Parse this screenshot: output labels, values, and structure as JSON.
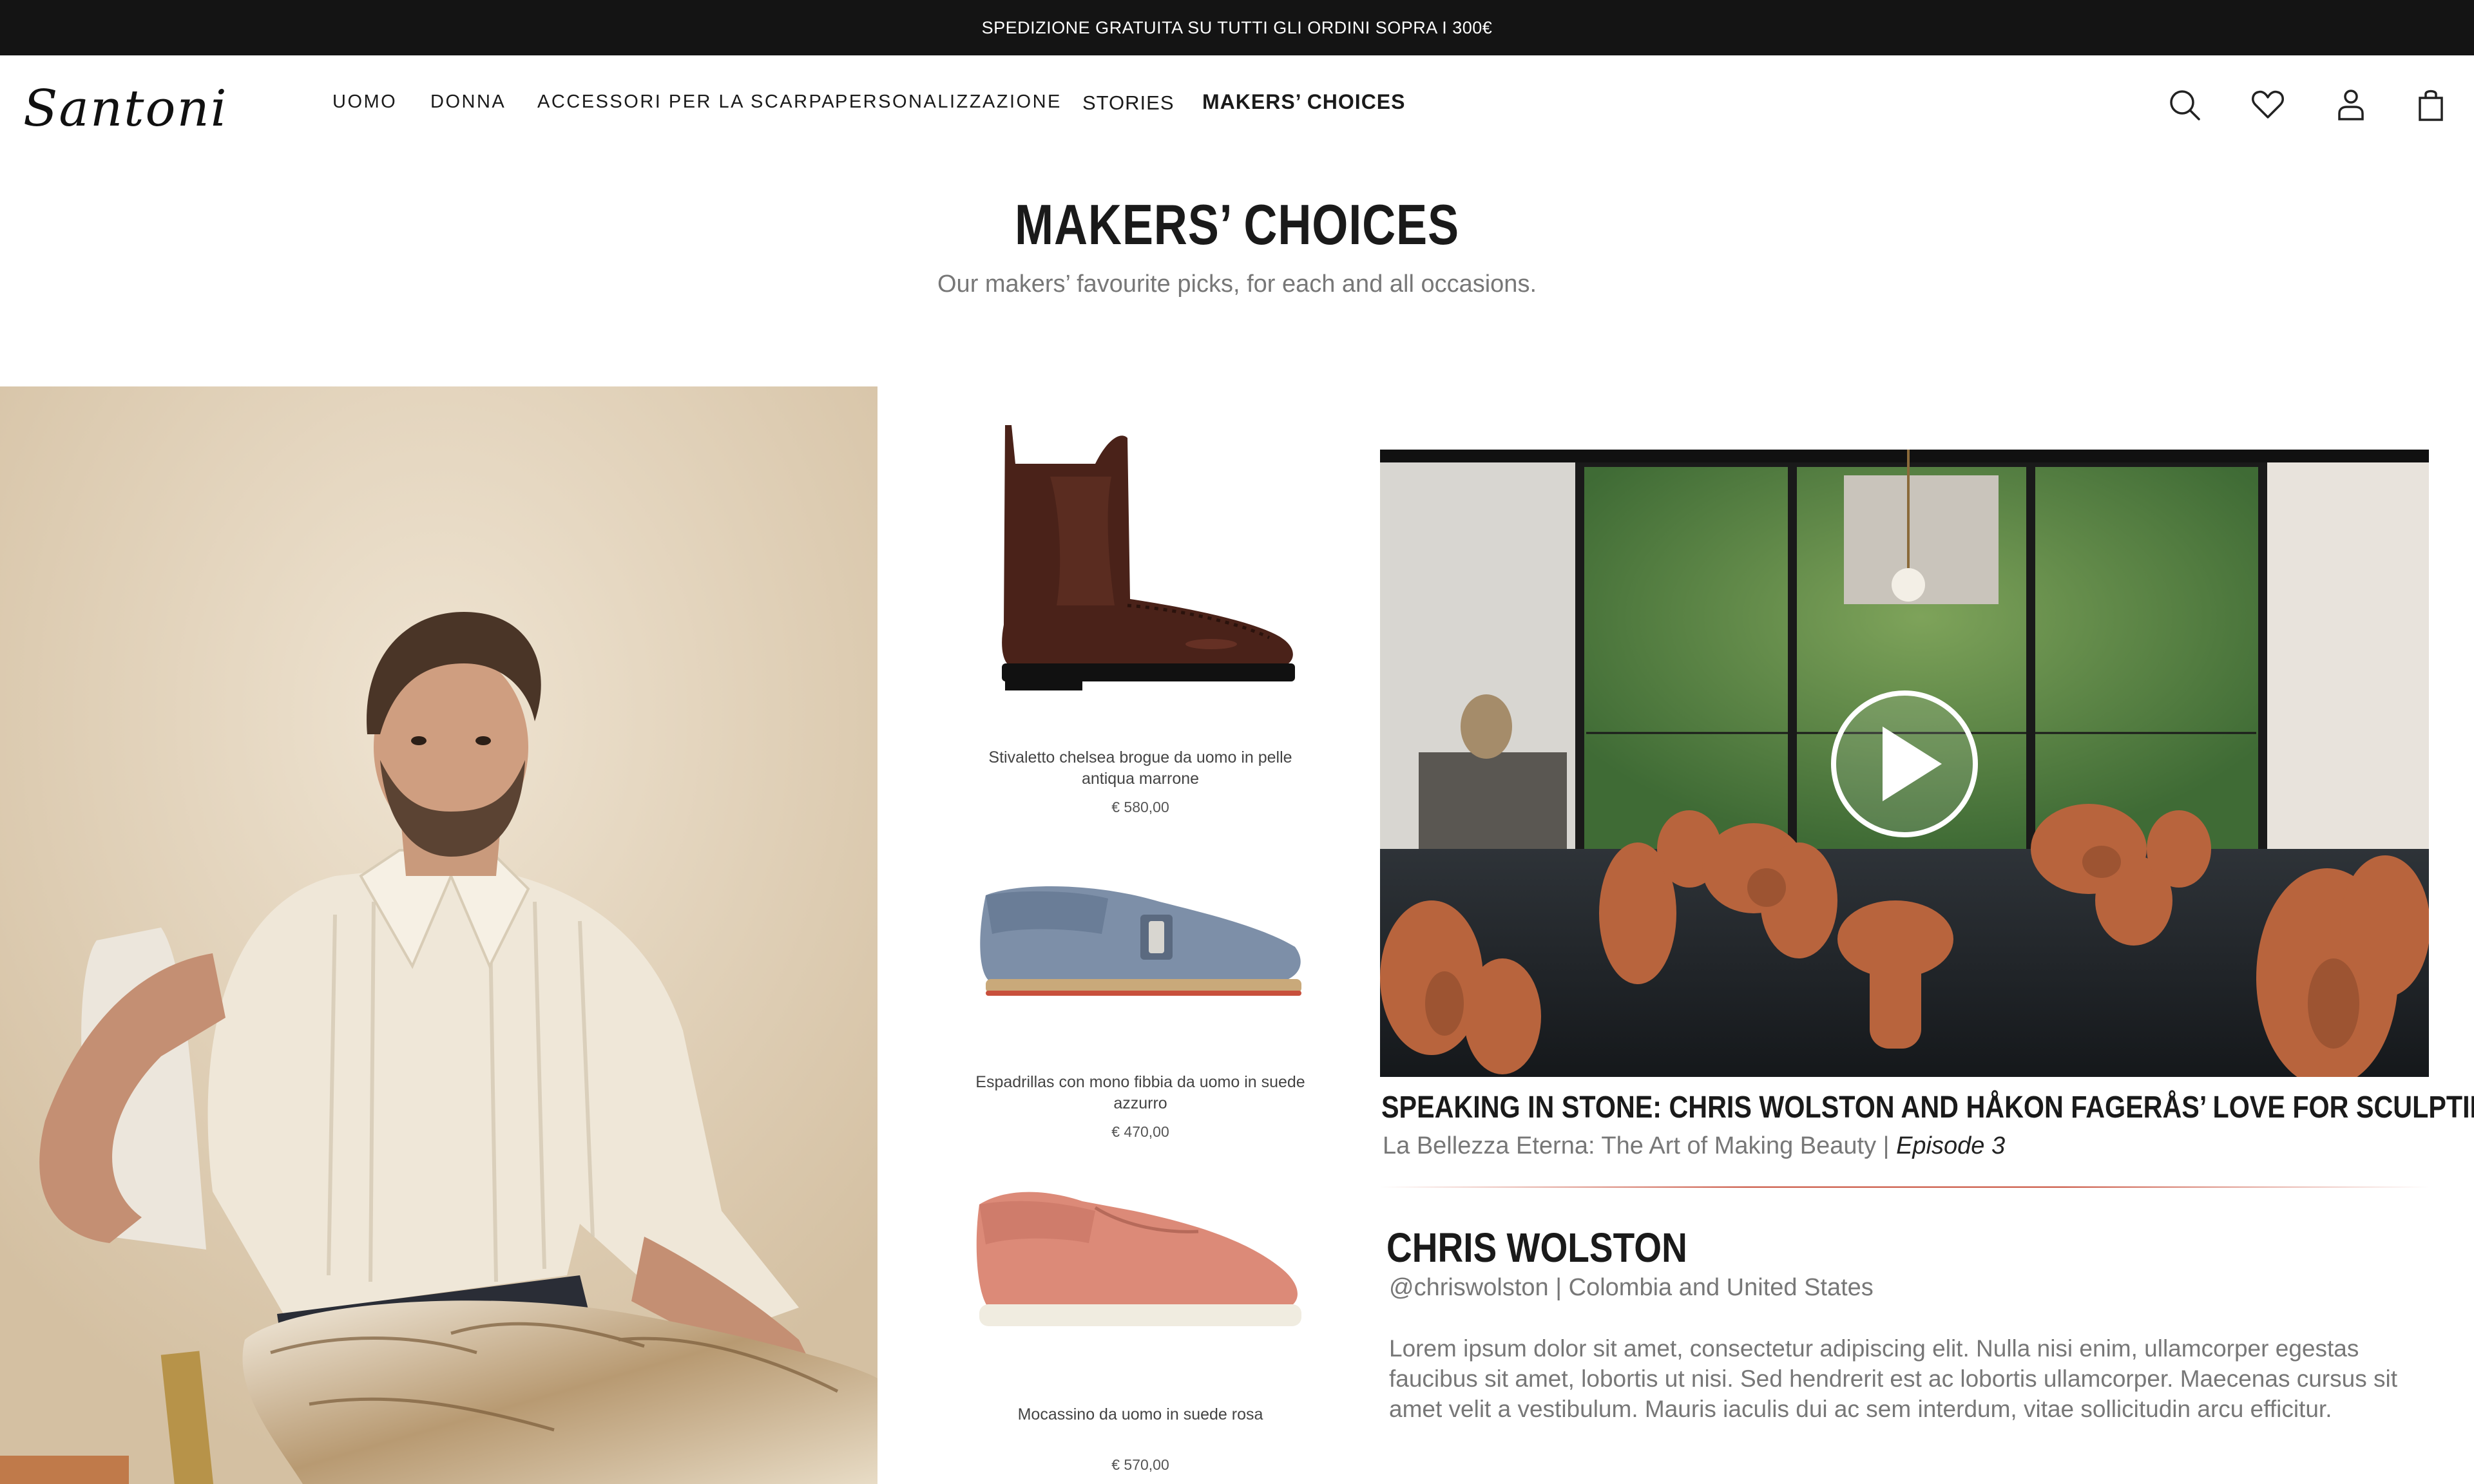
{
  "promo": {
    "text": "SPEDIZIONE GRATUITA SU TUTTI GLI ORDINI SOPRA I 300€"
  },
  "header": {
    "logo_text": "Santoni",
    "nav": [
      "UOMO",
      "DONNA",
      "ACCESSORI PER LA SCARPA",
      "PERSONALIZZAZIONE",
      "STORIES",
      "MAKERS’ CHOICES"
    ],
    "icons": [
      "search-icon",
      "heart-icon",
      "account-icon",
      "bag-icon"
    ]
  },
  "page": {
    "title": "MAKERS’ CHOICES",
    "subtitle": "Our makers’ favourite picks, for each and all occasions."
  },
  "products": [
    {
      "name": "Stivaletto chelsea brogue da uomo in pelle antiqua marrone",
      "price": "€ 580,00",
      "color": "#4a2219"
    },
    {
      "name": "Espadrillas con mono fibbia da uomo in suede azzurro",
      "price": "€ 470,00",
      "color": "#7d8fa8"
    },
    {
      "name": "Mocassino da uomo in suede rosa",
      "price": "€ 570,00",
      "color": "#dc8a78"
    }
  ],
  "story": {
    "title": "SPEAKING IN STONE: CHRIS WOLSTON AND HÅKON FAGERÅS’ LOVE FOR SCULPTING",
    "series": "La Bellezza Eterna: The Art of Making Beauty |",
    "episode": "Episode 3"
  },
  "maker": {
    "name": "CHRIS WOLSTON",
    "meta": "@chriswolston | Colombia and United States",
    "bio": "Lorem ipsum dolor sit amet, consectetur adipiscing elit. Nulla nisi enim, ullamcorper egestas faucibus sit amet, lobortis ut nisi. Sed hendrerit est ac lobortis ullamcorper. Maecenas cursus sit amet velit a vestibulum. Mauris iaculis dui ac sem interdum, vitae sollicitudin arcu efficitur."
  },
  "colors": {
    "promo_bg": "#141414",
    "accent_divider": "#c8503c",
    "terracotta": "#b8643d"
  }
}
